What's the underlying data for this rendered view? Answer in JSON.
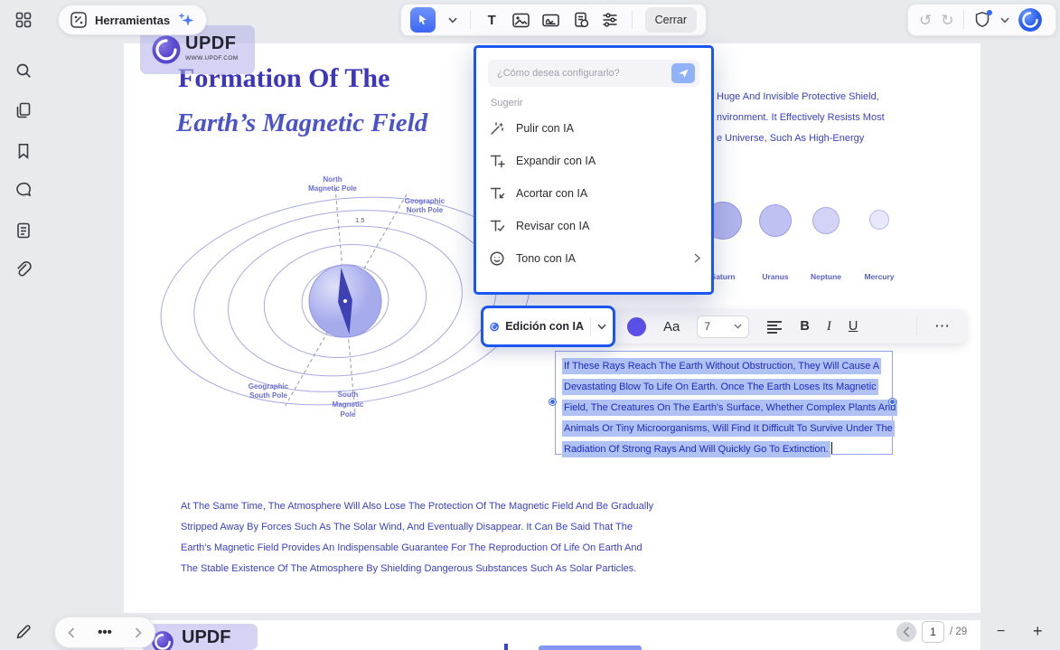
{
  "colors": {
    "accent_blue": "#1c56f1",
    "doc_text_blue": "#3a41c6",
    "selection_highlight": "#b0c2f4",
    "color_swatch": "#5b50e8"
  },
  "topbar": {
    "herramientas_label": "Herramientas",
    "cerrar_label": "Cerrar",
    "text_tool_glyph": "T",
    "undo_glyph": "↺",
    "redo_glyph": "↻"
  },
  "ai_popup": {
    "input_placeholder": "¿Cómo desea configurarlo?",
    "suggest_label": "Sugerir",
    "items": [
      {
        "label": "Pulir con IA",
        "icon": "polish-wand-icon"
      },
      {
        "label": "Expandir con IA",
        "icon": "expand-text-icon"
      },
      {
        "label": "Acortar con IA",
        "icon": "shorten-text-icon"
      },
      {
        "label": "Revisar con IA",
        "icon": "review-text-icon"
      },
      {
        "label": "Tono con IA",
        "icon": "tone-smiley-icon",
        "has_submenu": true
      }
    ]
  },
  "ai_edit_button": {
    "label": "Edición con IA"
  },
  "format_toolbar": {
    "font_sample": "Aa",
    "font_size": "7",
    "bold_glyph": "B",
    "italic_glyph": "I",
    "underline_glyph": "U",
    "more_glyph": "⋯"
  },
  "document": {
    "logo": {
      "brand": "UPDF",
      "site": "WWW.UPDF.COM"
    },
    "title_line1": "Formation Of The",
    "title_line2": "Earth’s Magnetic Field",
    "diagram_labels": {
      "north_magnetic_1": "North",
      "north_magnetic_2": "Magnetic Pole",
      "geo_north_1": "Geographic",
      "geo_north_2": "North Pole",
      "geo_south_1": "Geographic",
      "geo_south_2": "South Pole",
      "south_magnetic_1": "South",
      "south_magnetic_2": "Magnetic",
      "south_magnetic_3": "Pole",
      "angle_value": "1.5"
    },
    "planets": [
      {
        "name": "Saturn"
      },
      {
        "name": "Uranus"
      },
      {
        "name": "Neptune"
      },
      {
        "name": "Mercury"
      }
    ],
    "right_column_fragments": [
      "Huge And Invisible Protective Shield,",
      "nvironment. It Effectively Resists Most",
      "e Universe, Such As High-Energy"
    ],
    "selection_lines": [
      "If These Rays Reach The Earth Without Obstruction, They Will Cause A",
      "Devastating Blow To Life On Earth. Once The Earth Loses Its Magnetic",
      "Field, The Creatures On The Earth's Surface, Whether Complex Plants And",
      "Animals Or Tiny Microorganisms, Will Find It Difficult To Survive Under The",
      "Radiation Of Strong Rays And Will Quickly Go To Extinction."
    ],
    "bottom_paragraph_lines": [
      "At The Same Time, The Atmosphere Will Also Lose The Protection Of The Magnetic Field And Be Gradually",
      "Stripped Away By Forces Such As The Solar Wind, And Eventually Disappear. It Can Be Said That The",
      "Earth's Magnetic Field Provides An Indispensable Guarantee For The Reproduction Of Life On Earth And",
      "The Stable Existence Of The Atmosphere By Shielding Dangerous Substances Such As Solar Particles."
    ]
  },
  "page_nav": {
    "current_page": "1",
    "total_pages": "/ 29",
    "zoom_out_glyph": "−",
    "zoom_in_glyph": "+"
  },
  "bottom_nav": {
    "more_glyph": "•••"
  }
}
